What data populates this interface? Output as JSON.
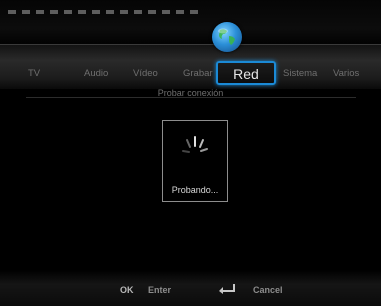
{
  "menu": {
    "tabs": [
      {
        "label": "TV"
      },
      {
        "label": "Audio"
      },
      {
        "label": "Vídeo"
      },
      {
        "label": "Grabar"
      },
      {
        "label": "Red",
        "active": true
      },
      {
        "label": "Sistema"
      },
      {
        "label": "Varios"
      }
    ]
  },
  "section": {
    "title": "Probar conexión"
  },
  "dialog": {
    "status": "Probando..."
  },
  "footer": {
    "ok_key": "OK",
    "ok_label": "Enter",
    "cancel_label": "Cancel"
  },
  "colors": {
    "accent": "#1b8ad6"
  }
}
